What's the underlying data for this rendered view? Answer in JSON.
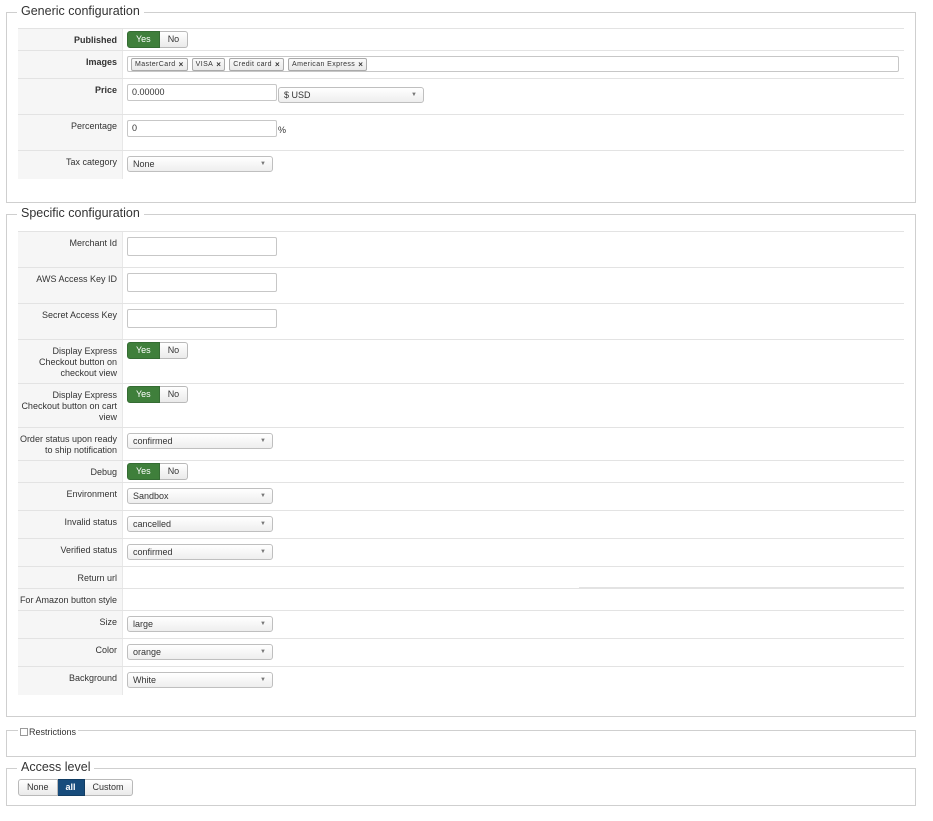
{
  "generic": {
    "legend": "Generic configuration",
    "published": {
      "label": "Published",
      "yes": "Yes",
      "no": "No",
      "selected": "Yes"
    },
    "images": {
      "label": "Images",
      "tags": [
        "MasterCard",
        "VISA",
        "Credit card",
        "American Express"
      ]
    },
    "price": {
      "label": "Price",
      "value": "0.00000",
      "currency": "$ USD"
    },
    "percentage": {
      "label": "Percentage",
      "value": "0",
      "unit": "%"
    },
    "tax_category": {
      "label": "Tax category",
      "value": "None"
    }
  },
  "specific": {
    "legend": "Specific configuration",
    "merchant_id": {
      "label": "Merchant Id",
      "value": ""
    },
    "aws_access_key_id": {
      "label": "AWS Access Key ID",
      "value": ""
    },
    "secret_access_key": {
      "label": "Secret Access Key",
      "value": ""
    },
    "display_express_checkout_view": {
      "label": "Display Express Checkout button on checkout view",
      "yes": "Yes",
      "no": "No",
      "selected": "Yes"
    },
    "display_express_cart_view": {
      "label": "Display Express Checkout button on cart view",
      "yes": "Yes",
      "no": "No",
      "selected": "Yes"
    },
    "order_status_ship": {
      "label": "Order status upon ready to ship notification",
      "value": "confirmed"
    },
    "debug": {
      "label": "Debug",
      "yes": "Yes",
      "no": "No",
      "selected": "Yes"
    },
    "environment": {
      "label": "Environment",
      "value": "Sandbox"
    },
    "invalid_status": {
      "label": "Invalid status",
      "value": "cancelled"
    },
    "verified_status": {
      "label": "Verified status",
      "value": "confirmed"
    },
    "return_url": {
      "label": "Return url"
    },
    "amazon_button_style": {
      "label": "For Amazon button style"
    },
    "size": {
      "label": "Size",
      "value": "large"
    },
    "color": {
      "label": "Color",
      "value": "orange"
    },
    "background": {
      "label": "Background",
      "value": "White"
    }
  },
  "restrictions": {
    "legend": "Restrictions"
  },
  "access": {
    "legend": "Access level",
    "options": [
      "None",
      "all",
      "Custom"
    ],
    "selected": "all"
  },
  "colors": {
    "toggle_green": "#3f7f3b",
    "toggle_blue": "#174c7c",
    "label_bg": "#f6f6f6",
    "border": "#cfcfcf"
  },
  "icons": {
    "tag_remove": "close-icon",
    "dropdown": "chevron-down-icon",
    "checkbox": "checkbox-icon"
  }
}
